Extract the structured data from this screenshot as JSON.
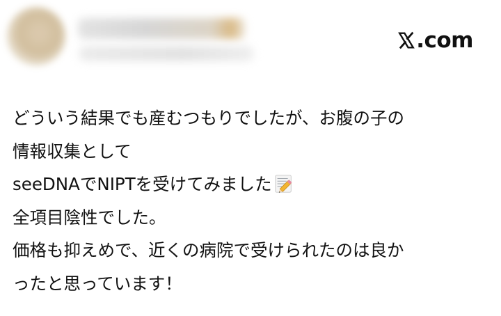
{
  "post": {
    "source_domain": "X.com",
    "source_suffix": ".com",
    "author_name": "",
    "author_handle": "",
    "lines": [
      "どういう結果でも産むつもりでしたが、お腹の子の",
      "情報収集として",
      "seeDNAでNIPTを受けてみました",
      "全項目陰性でした。",
      "価格も抑えめで、近くの病院で受けられたのは良か",
      "ったと思っています！"
    ],
    "inline_icon": "memo-pencil-icon"
  },
  "colors": {
    "text": "#111111",
    "background": "#ffffff"
  }
}
